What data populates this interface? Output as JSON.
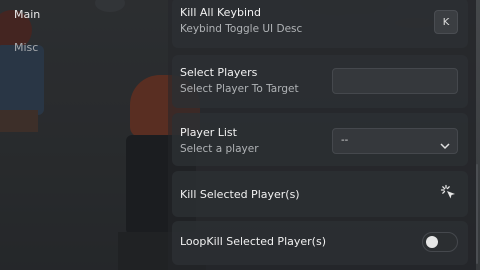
{
  "sidebar": {
    "tabs": [
      {
        "label": "Main"
      },
      {
        "label": "Misc"
      }
    ]
  },
  "rows": {
    "kill_all": {
      "title": "Kill All Keybind",
      "desc": "Keybind Toggle UI Desc",
      "key": "K"
    },
    "select_players": {
      "title": "Select Players",
      "desc": "Select Player To Target",
      "input_value": ""
    },
    "player_list": {
      "title": "Player List",
      "desc": "Select a player",
      "selected": "--"
    },
    "kill_selected": {
      "title": "Kill Selected Player(s)",
      "icon": "pointer-click-icon"
    },
    "loop_kill": {
      "title": "LoopKill Selected Player(s)",
      "enabled": false
    }
  }
}
